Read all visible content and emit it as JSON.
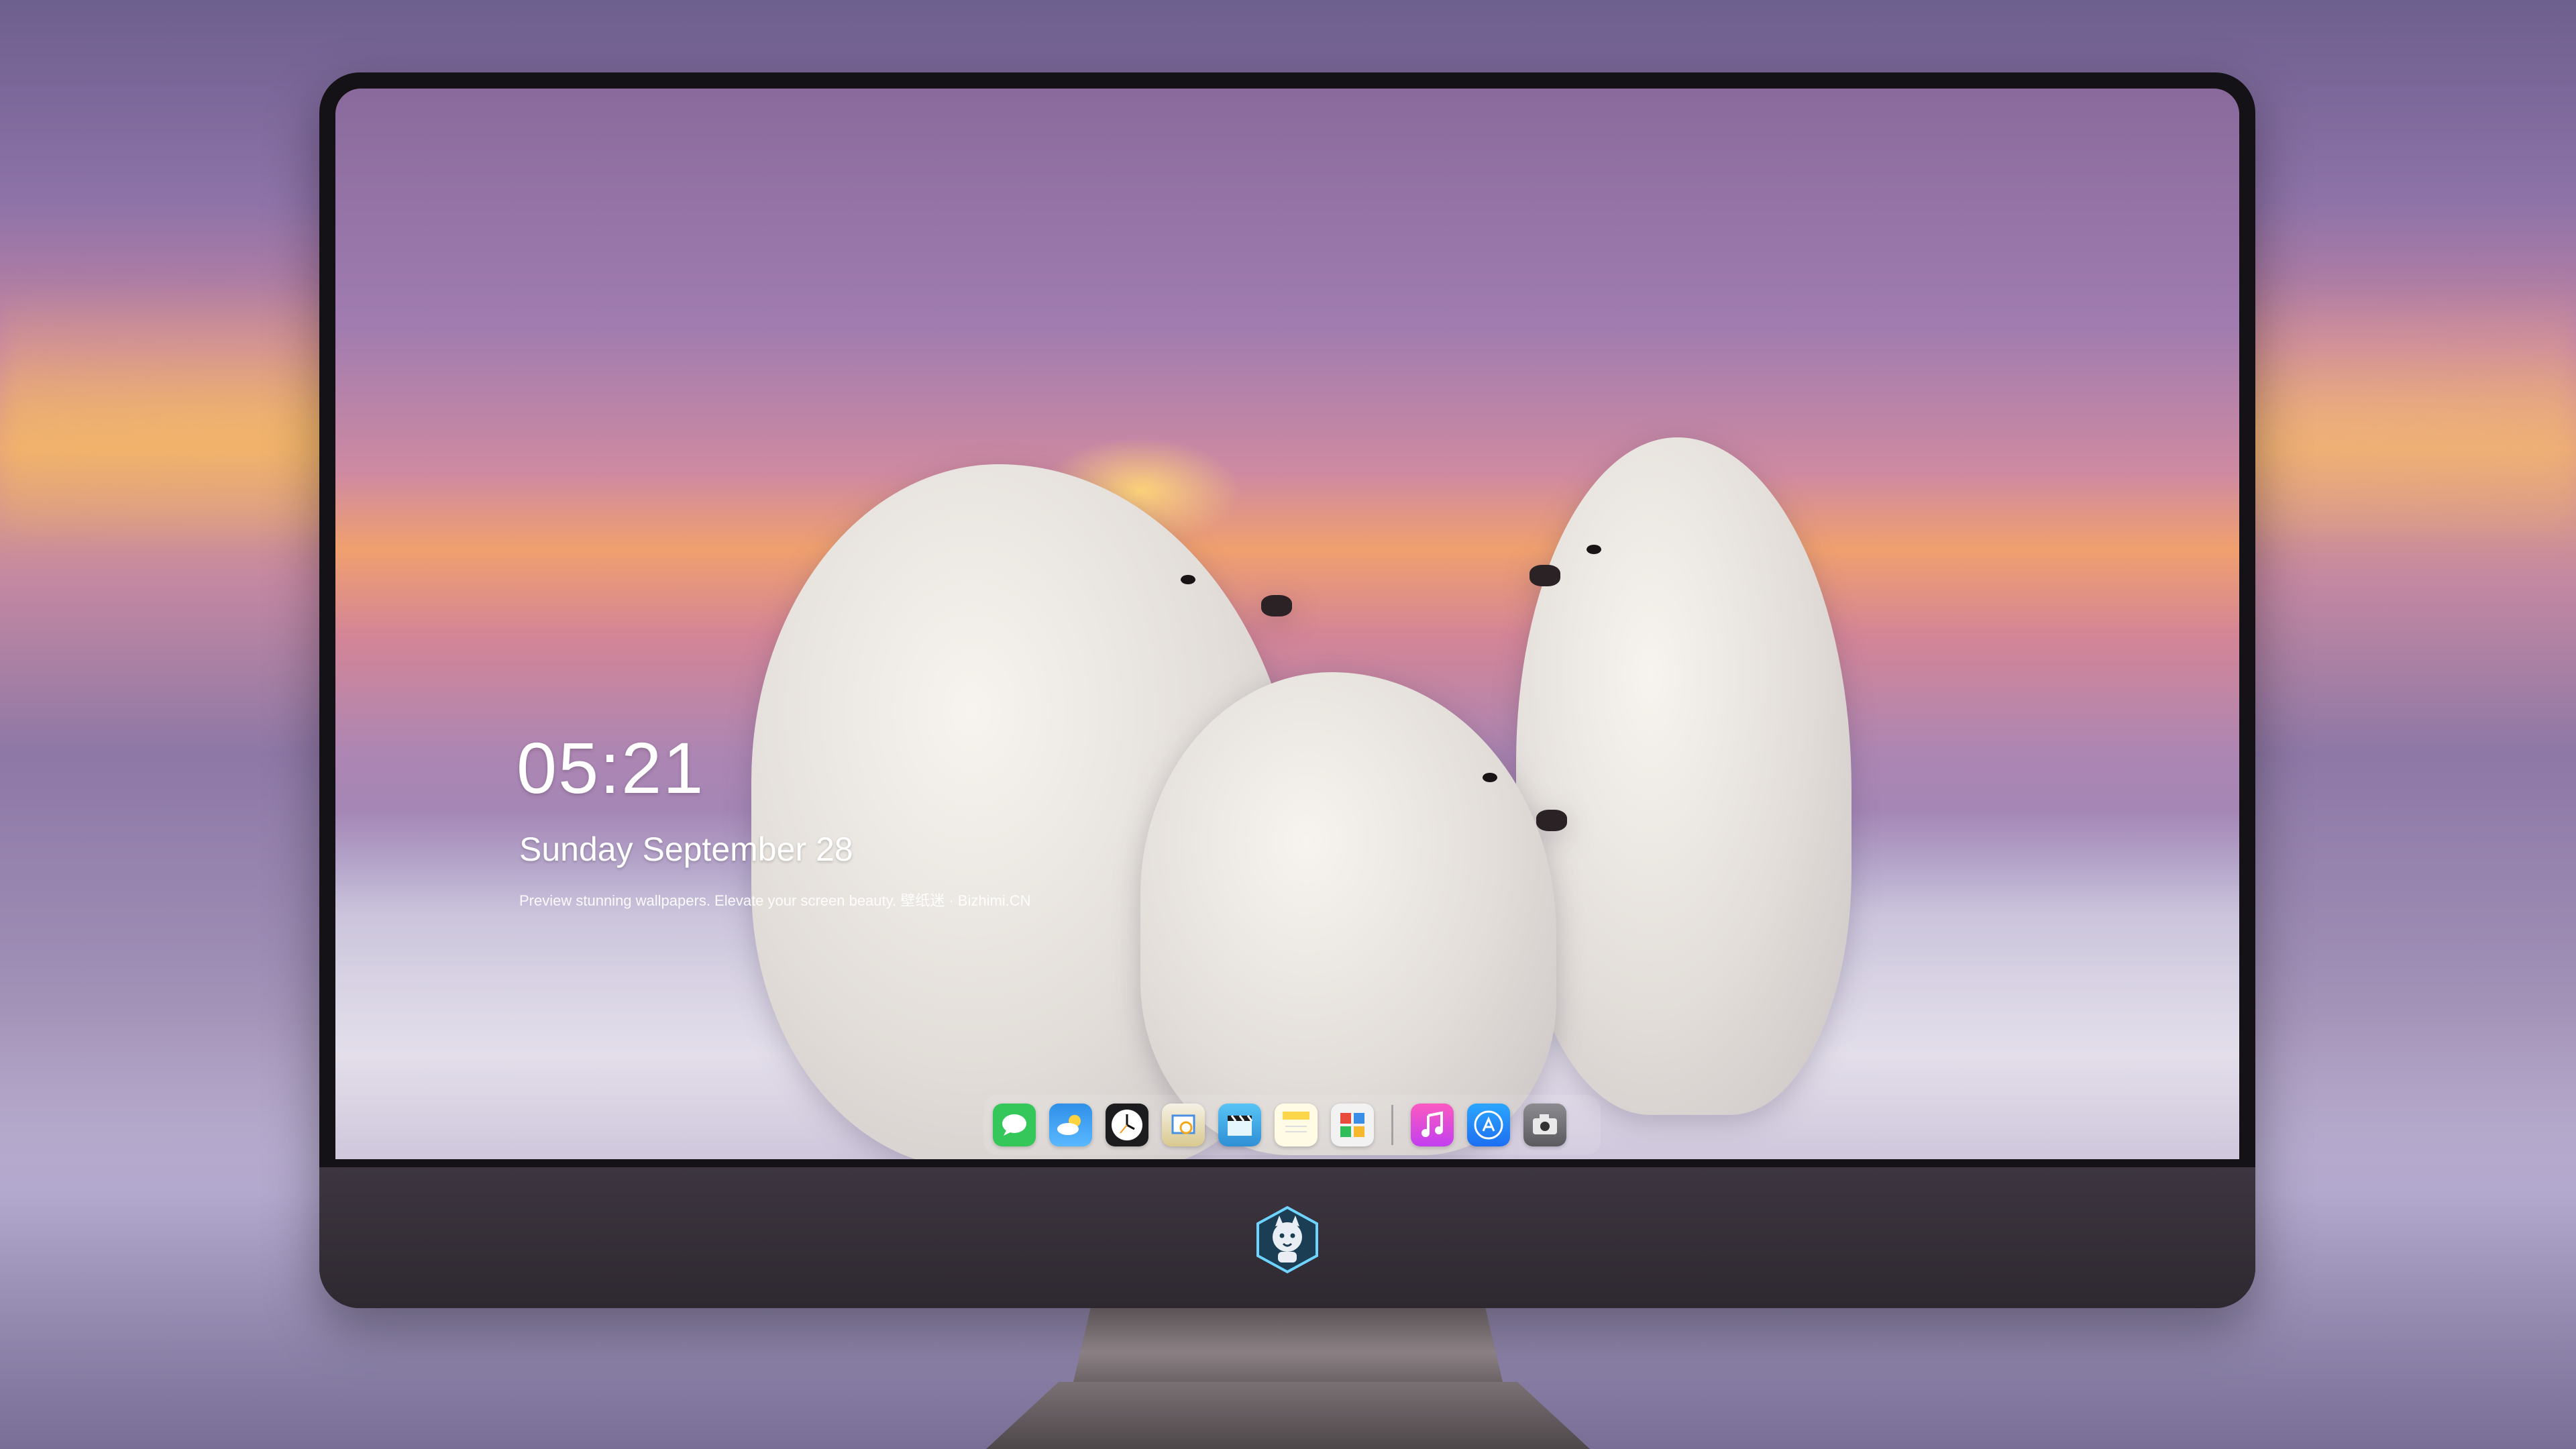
{
  "lock_screen": {
    "time": "05:21",
    "date": "Sunday September  28",
    "tagline": "Preview stunning wallpapers. Elevate your screen beauty. 壁纸迷 · Bizhimi.CN"
  },
  "dock": {
    "apps": [
      {
        "name": "messages-icon"
      },
      {
        "name": "weather-icon"
      },
      {
        "name": "clock-icon"
      },
      {
        "name": "preview-icon"
      },
      {
        "name": "clips-icon"
      },
      {
        "name": "notes-icon"
      },
      {
        "name": "photo-booth-icon"
      },
      {
        "name": "music-icon"
      },
      {
        "name": "app-store-icon"
      },
      {
        "name": "camera-icon"
      }
    ]
  },
  "monitor": {
    "logo": "wolf-mascot-logo"
  },
  "colors": {
    "messages": "#35c759",
    "weather": "#3aa0f0",
    "clock": "#1c1c1e",
    "clips": "#3fb4e8",
    "notes": "#ffd54a",
    "music": "#fa4ea6",
    "app_store": "#1e90ff",
    "camera": "#6e6e72"
  }
}
